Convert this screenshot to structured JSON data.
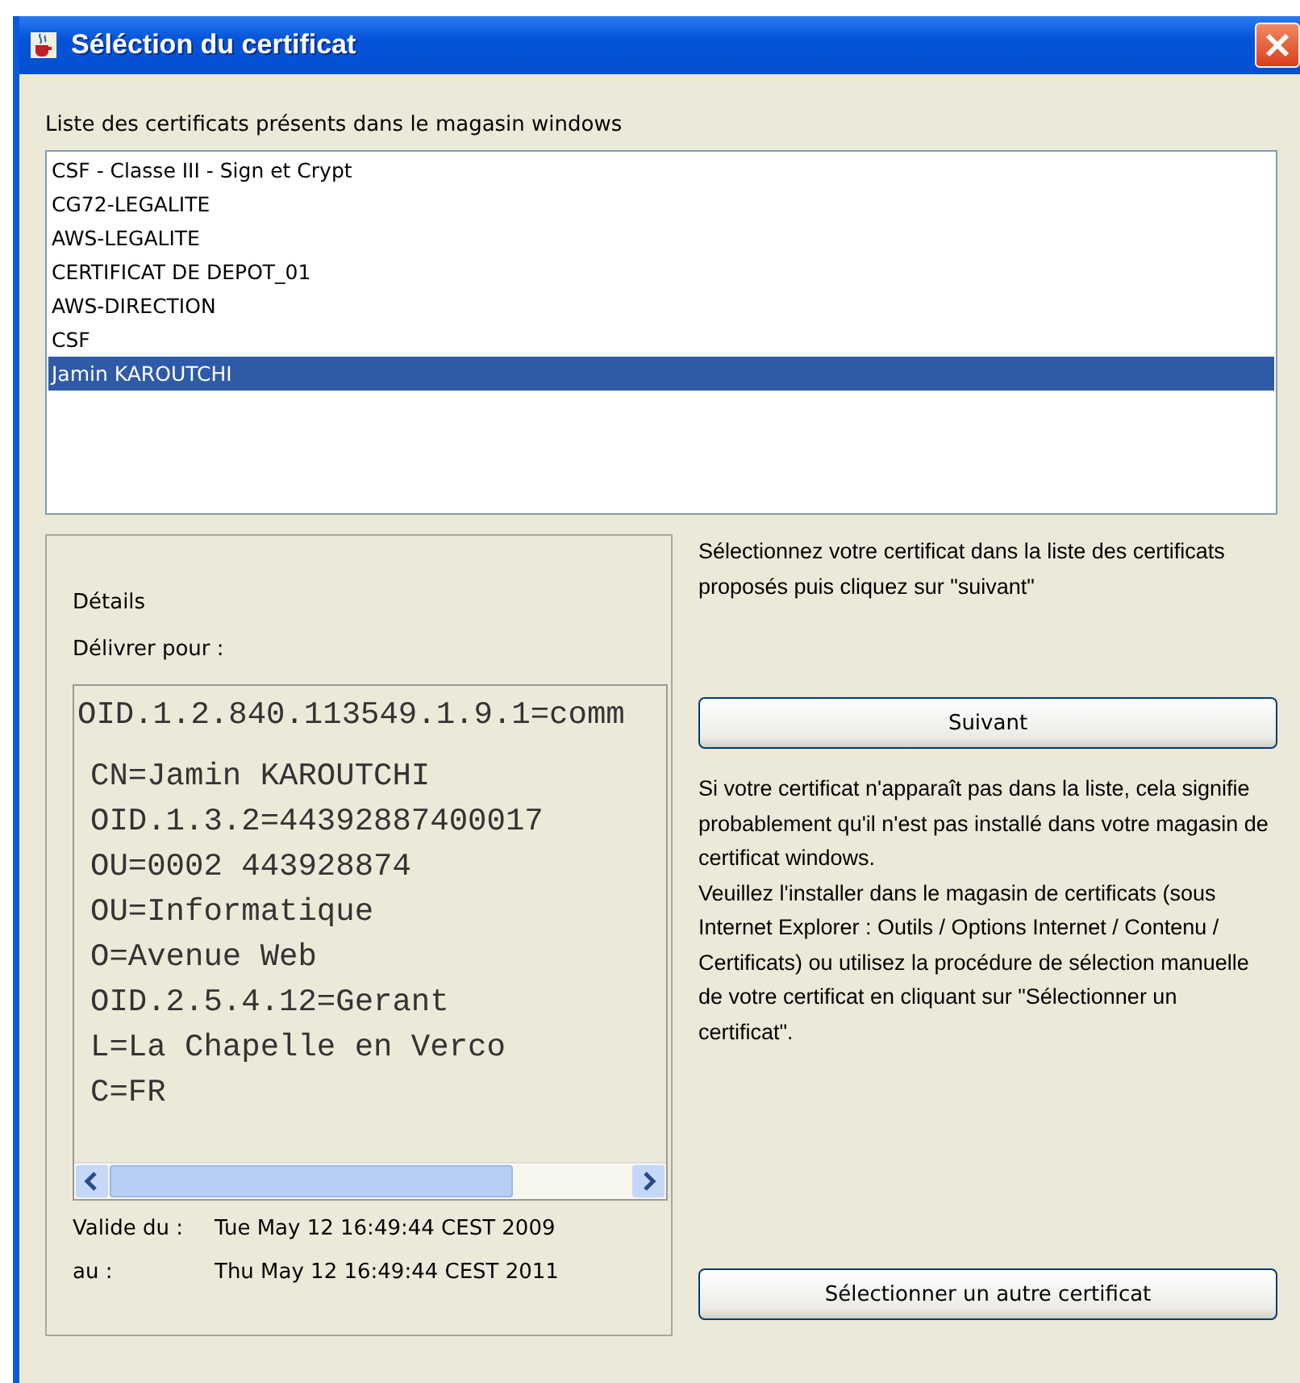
{
  "window": {
    "title": "Séléction du certificat"
  },
  "list_label": "Liste des certificats présents dans le magasin windows",
  "certificates": [
    {
      "label": "CSF - Classe III - Sign et Crypt",
      "selected": false
    },
    {
      "label": "CG72-LEGALITE",
      "selected": false
    },
    {
      "label": "AWS-LEGALITE",
      "selected": false
    },
    {
      "label": "CERTIFICAT DE DEPOT_01",
      "selected": false
    },
    {
      "label": "AWS-DIRECTION",
      "selected": false
    },
    {
      "label": "CSF",
      "selected": false
    },
    {
      "label": "Jamin KAROUTCHI",
      "selected": true
    }
  ],
  "details": {
    "title": "Détails",
    "issued_for_label": "Délivrer pour :",
    "subject_lines": [
      "OID.1.2.840.113549.1.9.1=comm",
      "CN=Jamin KAROUTCHI",
      "OID.1.3.2=44392887400017",
      "OU=0002 443928874",
      "OU=Informatique",
      "O=Avenue Web",
      "OID.2.5.4.12=Gerant",
      "L=La Chapelle en Verco",
      "C=FR"
    ],
    "valid_from_label": "Valide du :",
    "valid_from": "Tue May 12 16:49:44 CEST 2009",
    "valid_to_label": "au :",
    "valid_to": "Thu May 12 16:49:44 CEST 2011"
  },
  "instruction": "Sélectionnez votre certificat dans la liste des certificats proposés puis cliquez sur \"suivant\"",
  "next_button": "Suivant",
  "help_paragraphs": [
    "Si votre certificat n'apparaît pas dans la liste, cela signifie probablement qu'il n'est pas installé dans votre magasin de certificat windows.",
    "Veuillez l'installer dans le magasin de certificats (sous Internet Explorer : Outils / Options Internet / Contenu / Certificats) ou utilisez la procédure de sélection manuelle de votre certificat en cliquant sur \"Sélectionner un certificat\"."
  ],
  "other_button": "Sélectionner un autre certificat"
}
